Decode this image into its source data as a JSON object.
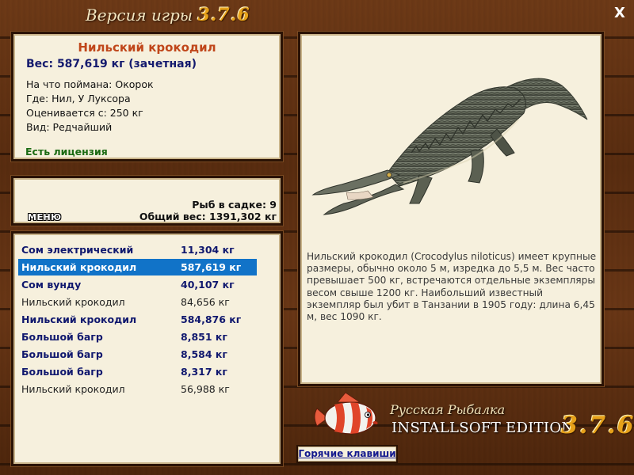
{
  "window": {
    "title": "Версия игры",
    "version": "3.7.6",
    "close_label": "X"
  },
  "fish_info": {
    "name": "Нильский крокодил",
    "weight_line": "Вес: 587,619 кг (зачетная)",
    "bait": "На что поймана: Окорок",
    "location": "Где: Нил, У Луксора",
    "valued_from": "Оценивается с: 250 кг",
    "species": "Вид: Редчайший",
    "license": "Есть лицензия"
  },
  "catch_summary": {
    "menu_label": "МЕНЮ",
    "fish_count": "Рыб в садке: 9",
    "total_weight": "Общий вес: 1391,302 кг"
  },
  "catch_list": [
    {
      "name": "Сом электрический",
      "weight": "11,304 кг",
      "trophy": true,
      "selected": false
    },
    {
      "name": "Нильский крокодил",
      "weight": "587,619 кг",
      "trophy": true,
      "selected": true
    },
    {
      "name": "Сом вунду",
      "weight": "40,107 кг",
      "trophy": true,
      "selected": false
    },
    {
      "name": "Нильский крокодил",
      "weight": "84,656 кг",
      "trophy": false,
      "selected": false
    },
    {
      "name": "Нильский крокодил",
      "weight": "584,876 кг",
      "trophy": true,
      "selected": false
    },
    {
      "name": "Большой багр",
      "weight": "8,851 кг",
      "trophy": true,
      "selected": false
    },
    {
      "name": "Большой багр",
      "weight": "8,584 кг",
      "trophy": true,
      "selected": false
    },
    {
      "name": "Большой багр",
      "weight": "8,317 кг",
      "trophy": true,
      "selected": false
    },
    {
      "name": "Нильский крокодил",
      "weight": "56,988 кг",
      "trophy": false,
      "selected": false
    }
  ],
  "description": "Нильский крокодил (Crocodylus niloticus) имеет крупные размеры, обычно около 5 м, изредка до 5,5 м. Вес часто превышает 500 кг, встречаются отдельные экземпляры весом свыше 1200 кг. Наибольший известный экземпляр был убит в Танзании в 1905 году: длина 6,45 м, вес 1090 кг.",
  "branding": {
    "line1": "Русская Рыбалка",
    "line2": "INSTALLSOFT EDITION",
    "version": "3.7.6"
  },
  "hotkeys_label": "Горячие клавиши",
  "colors": {
    "trophy_text": "#10186e",
    "selected_bg": "#1173c8",
    "fish_name": "#c0461a",
    "license": "#1a6a12",
    "version_gold": "#e6a11a"
  }
}
